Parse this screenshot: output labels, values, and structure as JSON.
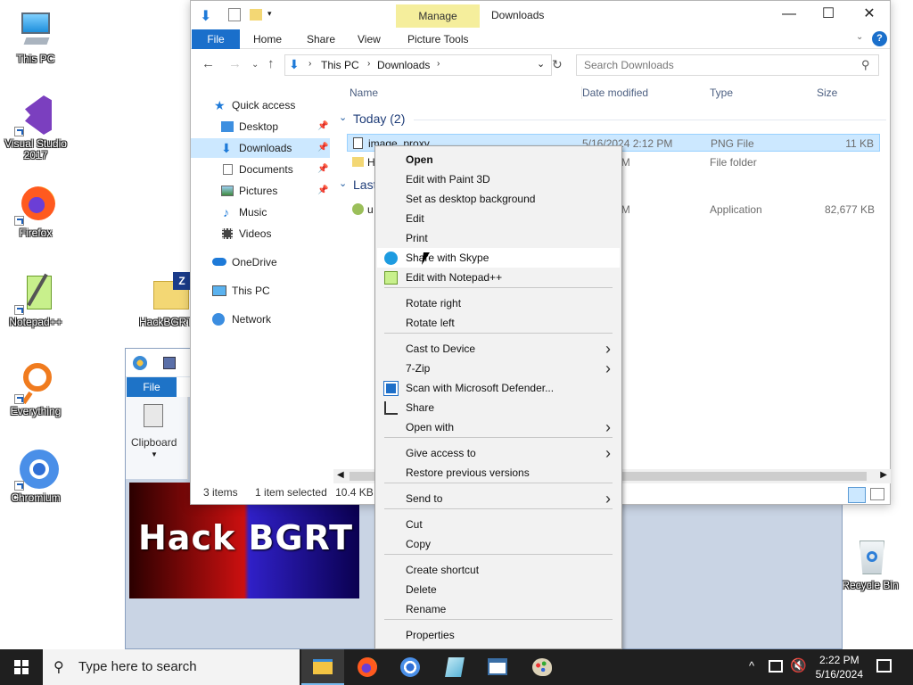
{
  "desktop": {
    "icons": [
      {
        "label": "This PC"
      },
      {
        "label": "Visual Studio 2017"
      },
      {
        "label": "Firefox"
      },
      {
        "label": "Notepad++"
      },
      {
        "label": "HackBGRT"
      },
      {
        "label": "Everything"
      },
      {
        "label": "Chromium"
      },
      {
        "label": "Recycle Bin"
      }
    ]
  },
  "paint": {
    "file_tab": "File",
    "clipboard": "Clipboard",
    "canvas_text": "Hack BGRT"
  },
  "explorer": {
    "manage_tab": "Manage",
    "title": "Downloads",
    "ribbon_tabs": [
      "File",
      "Home",
      "Share",
      "View",
      "Picture Tools"
    ],
    "breadcrumb": [
      "This PC",
      "Downloads"
    ],
    "search_placeholder": "Search Downloads",
    "sidebar": [
      {
        "label": "Quick access"
      },
      {
        "label": "Desktop"
      },
      {
        "label": "Downloads"
      },
      {
        "label": "Documents"
      },
      {
        "label": "Pictures"
      },
      {
        "label": "Music"
      },
      {
        "label": "Videos"
      },
      {
        "label": "OneDrive"
      },
      {
        "label": "This PC"
      },
      {
        "label": "Network"
      }
    ],
    "columns": [
      "Name",
      "Date modified",
      "Type",
      "Size"
    ],
    "groups": {
      "today": "Today (2)",
      "last": "Last"
    },
    "rows": [
      {
        "name": "image_proxy",
        "date": "5/16/2024 2:12 PM",
        "type": "PNG File",
        "size": "11 KB"
      },
      {
        "name": "H",
        "date": "4 2:18 PM",
        "type": "File folder",
        "size": ""
      },
      {
        "name": "u",
        "date": "4 3:53 PM",
        "type": "Application",
        "size": "82,677 KB"
      }
    ],
    "status": {
      "items": "3 items",
      "selected": "1 item selected",
      "size": "10.4 KB"
    }
  },
  "context_menu": {
    "items": [
      "Open",
      "Edit with Paint 3D",
      "Set as desktop background",
      "Edit",
      "Print",
      "Share with Skype",
      "Edit with Notepad++",
      "Rotate right",
      "Rotate left",
      "Cast to Device",
      "7-Zip",
      "Scan with Microsoft Defender...",
      "Share",
      "Open with",
      "Give access to",
      "Restore previous versions",
      "Send to",
      "Cut",
      "Copy",
      "Create shortcut",
      "Delete",
      "Rename",
      "Properties"
    ]
  },
  "taskbar": {
    "search_placeholder": "Type here to search",
    "time": "2:22 PM",
    "date": "5/16/2024"
  }
}
